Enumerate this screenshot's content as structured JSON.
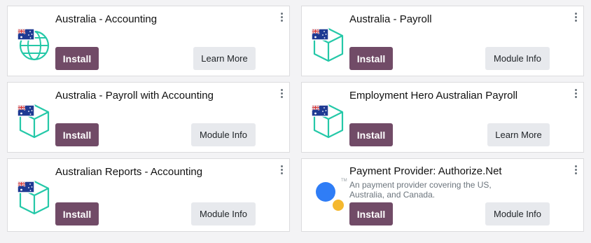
{
  "colors": {
    "install_button": "#714b67",
    "secondary_button": "#e7e9ed",
    "icon_teal": "#25c8a8",
    "flag_blue": "#1f3a93",
    "flag_red": "#d32f2f",
    "provider_blue": "#2f7df6",
    "provider_yellow": "#f5b82e"
  },
  "cards": [
    {
      "title": "Australia - Accounting",
      "icon": "globe-with-au-flag-icon",
      "install_label": "Install",
      "secondary_label": "Learn More"
    },
    {
      "title": "Australia - Payroll",
      "icon": "box-with-au-flag-icon",
      "install_label": "Install",
      "secondary_label": "Module Info"
    },
    {
      "title": "Australia - Payroll with Accounting",
      "icon": "box-with-au-flag-icon",
      "install_label": "Install",
      "secondary_label": "Module Info"
    },
    {
      "title": "Employment Hero Australian Payroll",
      "icon": "box-with-au-flag-icon",
      "install_label": "Install",
      "secondary_label": "Learn More"
    },
    {
      "title": "Australian Reports - Accounting",
      "icon": "box-with-au-flag-icon",
      "install_label": "Install",
      "secondary_label": "Module Info"
    },
    {
      "title": "Payment Provider: Authorize.Net",
      "description": "An payment provider covering the US, Australia, and Canada.",
      "icon": "authorize-net-logo-icon",
      "icon_mark": "TM",
      "install_label": "Install",
      "secondary_label": "Module Info"
    }
  ]
}
